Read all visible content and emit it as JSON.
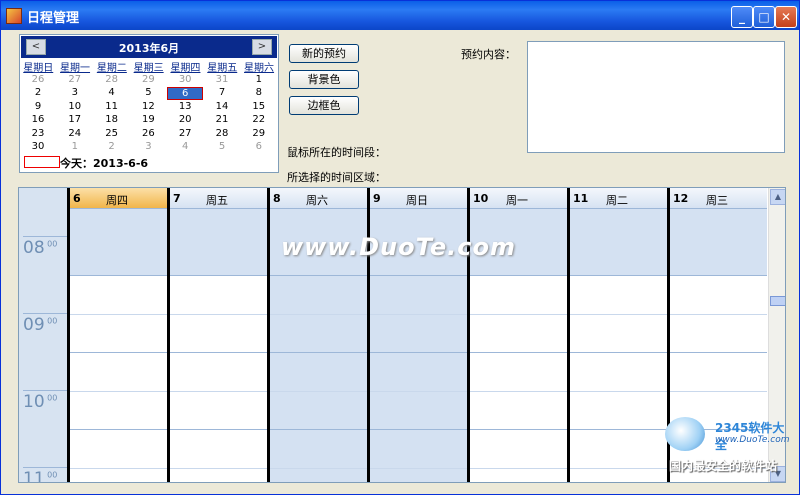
{
  "window": {
    "title": "日程管理",
    "minimize": "_",
    "maximize": "□",
    "close": "✕"
  },
  "calendar": {
    "month": "2013年6月",
    "prev": "<",
    "next": ">",
    "weekdays": [
      "星期日",
      "星期一",
      "星期二",
      "星期三",
      "星期四",
      "星期五",
      "星期六"
    ],
    "weeks": [
      [
        "26",
        "27",
        "28",
        "29",
        "30",
        "31",
        "1"
      ],
      [
        "2",
        "3",
        "4",
        "5",
        "6",
        "7",
        "8"
      ],
      [
        "9",
        "10",
        "11",
        "12",
        "13",
        "14",
        "15"
      ],
      [
        "16",
        "17",
        "18",
        "19",
        "20",
        "21",
        "22"
      ],
      [
        "23",
        "24",
        "25",
        "26",
        "27",
        "28",
        "29"
      ],
      [
        "30",
        "1",
        "2",
        "3",
        "4",
        "5",
        "6"
      ]
    ],
    "selected": "6",
    "today_label": "今天：",
    "today_date": "2013-6-6"
  },
  "buttons": {
    "new_appointment": "新的预约",
    "background_color": "背景色",
    "border_color": "边框色"
  },
  "labels": {
    "appointment_content": "预约内容：",
    "mouse_timeslot": "鼠标所在的时间段：",
    "selected_range": "所选择的时间区域："
  },
  "scheduler": {
    "days": [
      {
        "num": "6",
        "name": "周四",
        "today": true
      },
      {
        "num": "7",
        "name": "周五"
      },
      {
        "num": "8",
        "name": "周六"
      },
      {
        "num": "9",
        "name": "周日"
      },
      {
        "num": "10",
        "name": "周一"
      },
      {
        "num": "11",
        "name": "周二"
      },
      {
        "num": "12",
        "name": "周三"
      }
    ],
    "hours": [
      "08",
      "09",
      "10",
      "11"
    ],
    "minutes": "00"
  },
  "watermark": "www.DuoTe.com",
  "logo": {
    "brand": "2345软件大全",
    "url": "www.DuoTe.com",
    "slogan": "国内最安全的软件站"
  },
  "colors": {
    "titlebar": "#0A5FE8",
    "calendar_header": "#0A2A8C",
    "timecolumn": "#D7E3F1",
    "workhours": "#FFFFFF",
    "offhours": "#D4E1F2",
    "today_header": "#F1B54A"
  }
}
